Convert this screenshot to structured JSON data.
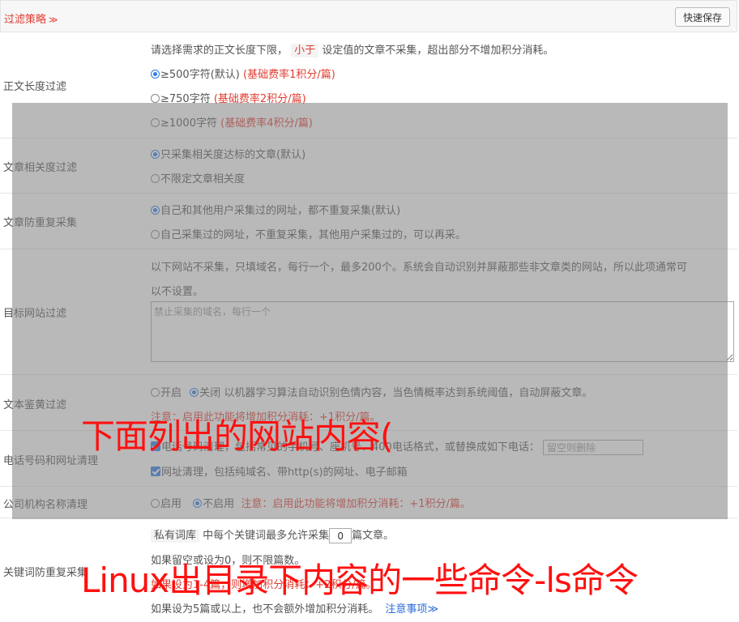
{
  "header": {
    "title": "过滤策略",
    "save_label": "快速保存"
  },
  "length_filter": {
    "label": "正文长度过滤",
    "desc_before": "请选择需求的正文长度下限，",
    "desc_tag": "小于",
    "desc_after": "设定值的文章不采集，超出部分不增加积分消耗。",
    "options": [
      {
        "text": "≥500字符(默认)",
        "note": "(基础费率1积分/篇)",
        "selected": true
      },
      {
        "text": "≥750字符",
        "note": "(基础费率2积分/篇)",
        "selected": false
      },
      {
        "text": "≥1000字符",
        "note": "(基础费率4积分/篇)",
        "selected": false
      }
    ]
  },
  "relevance": {
    "label": "文章相关度过滤",
    "options": [
      {
        "text": "只采集相关度达标的文章(默认)",
        "selected": true
      },
      {
        "text": "不限定文章相关度",
        "selected": false
      }
    ]
  },
  "dedupe": {
    "label": "文章防重复采集",
    "options": [
      {
        "text": "自己和其他用户采集过的网址，都不重复采集(默认)",
        "selected": true
      },
      {
        "text": "自己采集过的网址，不重复采集，其他用户采集过的，可以再采。",
        "selected": false
      }
    ]
  },
  "site_filter": {
    "label": "目标网站过滤",
    "desc_line1": "以下网站不采集，只填域名，每行一个，最多200个。系统会自动识别并屏蔽那些非文章类的网站，所以此项通常可",
    "desc_line2": "以不设置。",
    "placeholder": "禁止采集的域名，每行一个"
  },
  "porn_filter": {
    "label": "文本鉴黄过滤",
    "on_label": "开启",
    "off_label": "关闭",
    "desc": "以机器学习算法自动识别色情内容，当色情概率达到系统阈值，自动屏蔽文章。",
    "note": "注意：启用此功能将增加积分消耗：+1积分/篇。"
  },
  "phone_clean": {
    "label": "电话号码和网址清理",
    "phone_text": "电话号码清理，包括常见的手机号、座机号、400电话格式，或替换成如下电话：",
    "phone_placeholder": "留空则删除",
    "url_text": "网址清理，包括纯域名、带http(s)的网址、电子邮箱"
  },
  "company": {
    "label": "公司机构名称清理",
    "on_label": "启用",
    "off_label": "不启用",
    "note": "注意：启用此功能将增加积分消耗：+1积分/篇。"
  },
  "keyword_dedupe": {
    "label": "关键词防重复采集",
    "tag": "私有词库",
    "line1_mid": "中每个关键词最多允许采集",
    "count": "0",
    "line1_end": "篇文章。",
    "line2": "如果留空或设为0，则不限篇数。",
    "line3": "如果设为1-4篇，则增加积分消耗：+2积分/篇。",
    "line4": "如果设为5篇或以上，也不会额外增加积分消耗。",
    "link": "注意事项"
  },
  "captions": {
    "top": "下面列出的网站内容(",
    "bottom": "Linux出目录下内容的一些命令-ls命令"
  }
}
